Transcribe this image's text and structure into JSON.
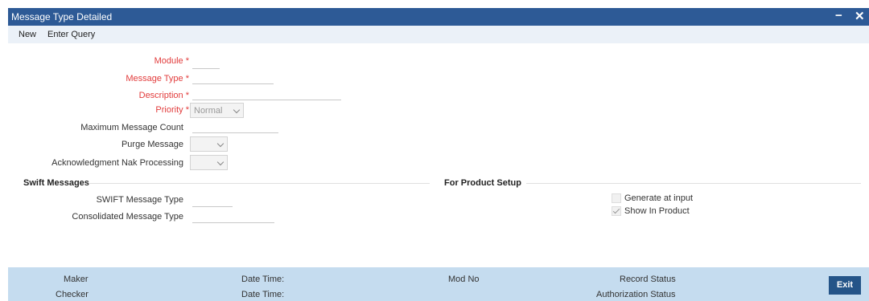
{
  "window": {
    "title": "Message Type Detailed",
    "minimize_glyph": "−",
    "close_glyph": "✕"
  },
  "toolbar": {
    "new_label": "New",
    "enter_query_label": "Enter Query"
  },
  "form": {
    "module": {
      "label": "Module",
      "required_mark": "*",
      "value": ""
    },
    "message_type": {
      "label": "Message Type",
      "required_mark": "*",
      "value": ""
    },
    "description": {
      "label": "Description",
      "required_mark": "*",
      "value": ""
    },
    "priority": {
      "label": "Priority",
      "required_mark": "*",
      "selected": "Normal"
    },
    "max_message_count": {
      "label": "Maximum Message Count",
      "value": ""
    },
    "purge_message": {
      "label": "Purge Message",
      "selected": ""
    },
    "ack_nak_processing": {
      "label": "Acknowledgment Nak Processing",
      "selected": ""
    }
  },
  "swift": {
    "heading": "Swift Messages",
    "swift_message_type": {
      "label": "SWIFT Message Type",
      "value": ""
    },
    "consolidated_message_type": {
      "label": "Consolidated Message Type",
      "value": ""
    }
  },
  "product_setup": {
    "heading": "For Product Setup",
    "generate_at_input": {
      "label": "Generate at input",
      "checked": false
    },
    "show_in_product": {
      "label": "Show In Product",
      "checked": true
    }
  },
  "footer": {
    "maker_label": "Maker",
    "checker_label": "Checker",
    "date_time_label_1": "Date Time:",
    "date_time_label_2": "Date Time:",
    "mod_no_label": "Mod No",
    "record_status_label": "Record Status",
    "authorization_status_label": "Authorization Status",
    "exit_label": "Exit"
  },
  "colors": {
    "title_bar": "#2d5a96",
    "footer": "#c5dcef",
    "exit_button": "#245488",
    "required": "#e23c3c"
  }
}
